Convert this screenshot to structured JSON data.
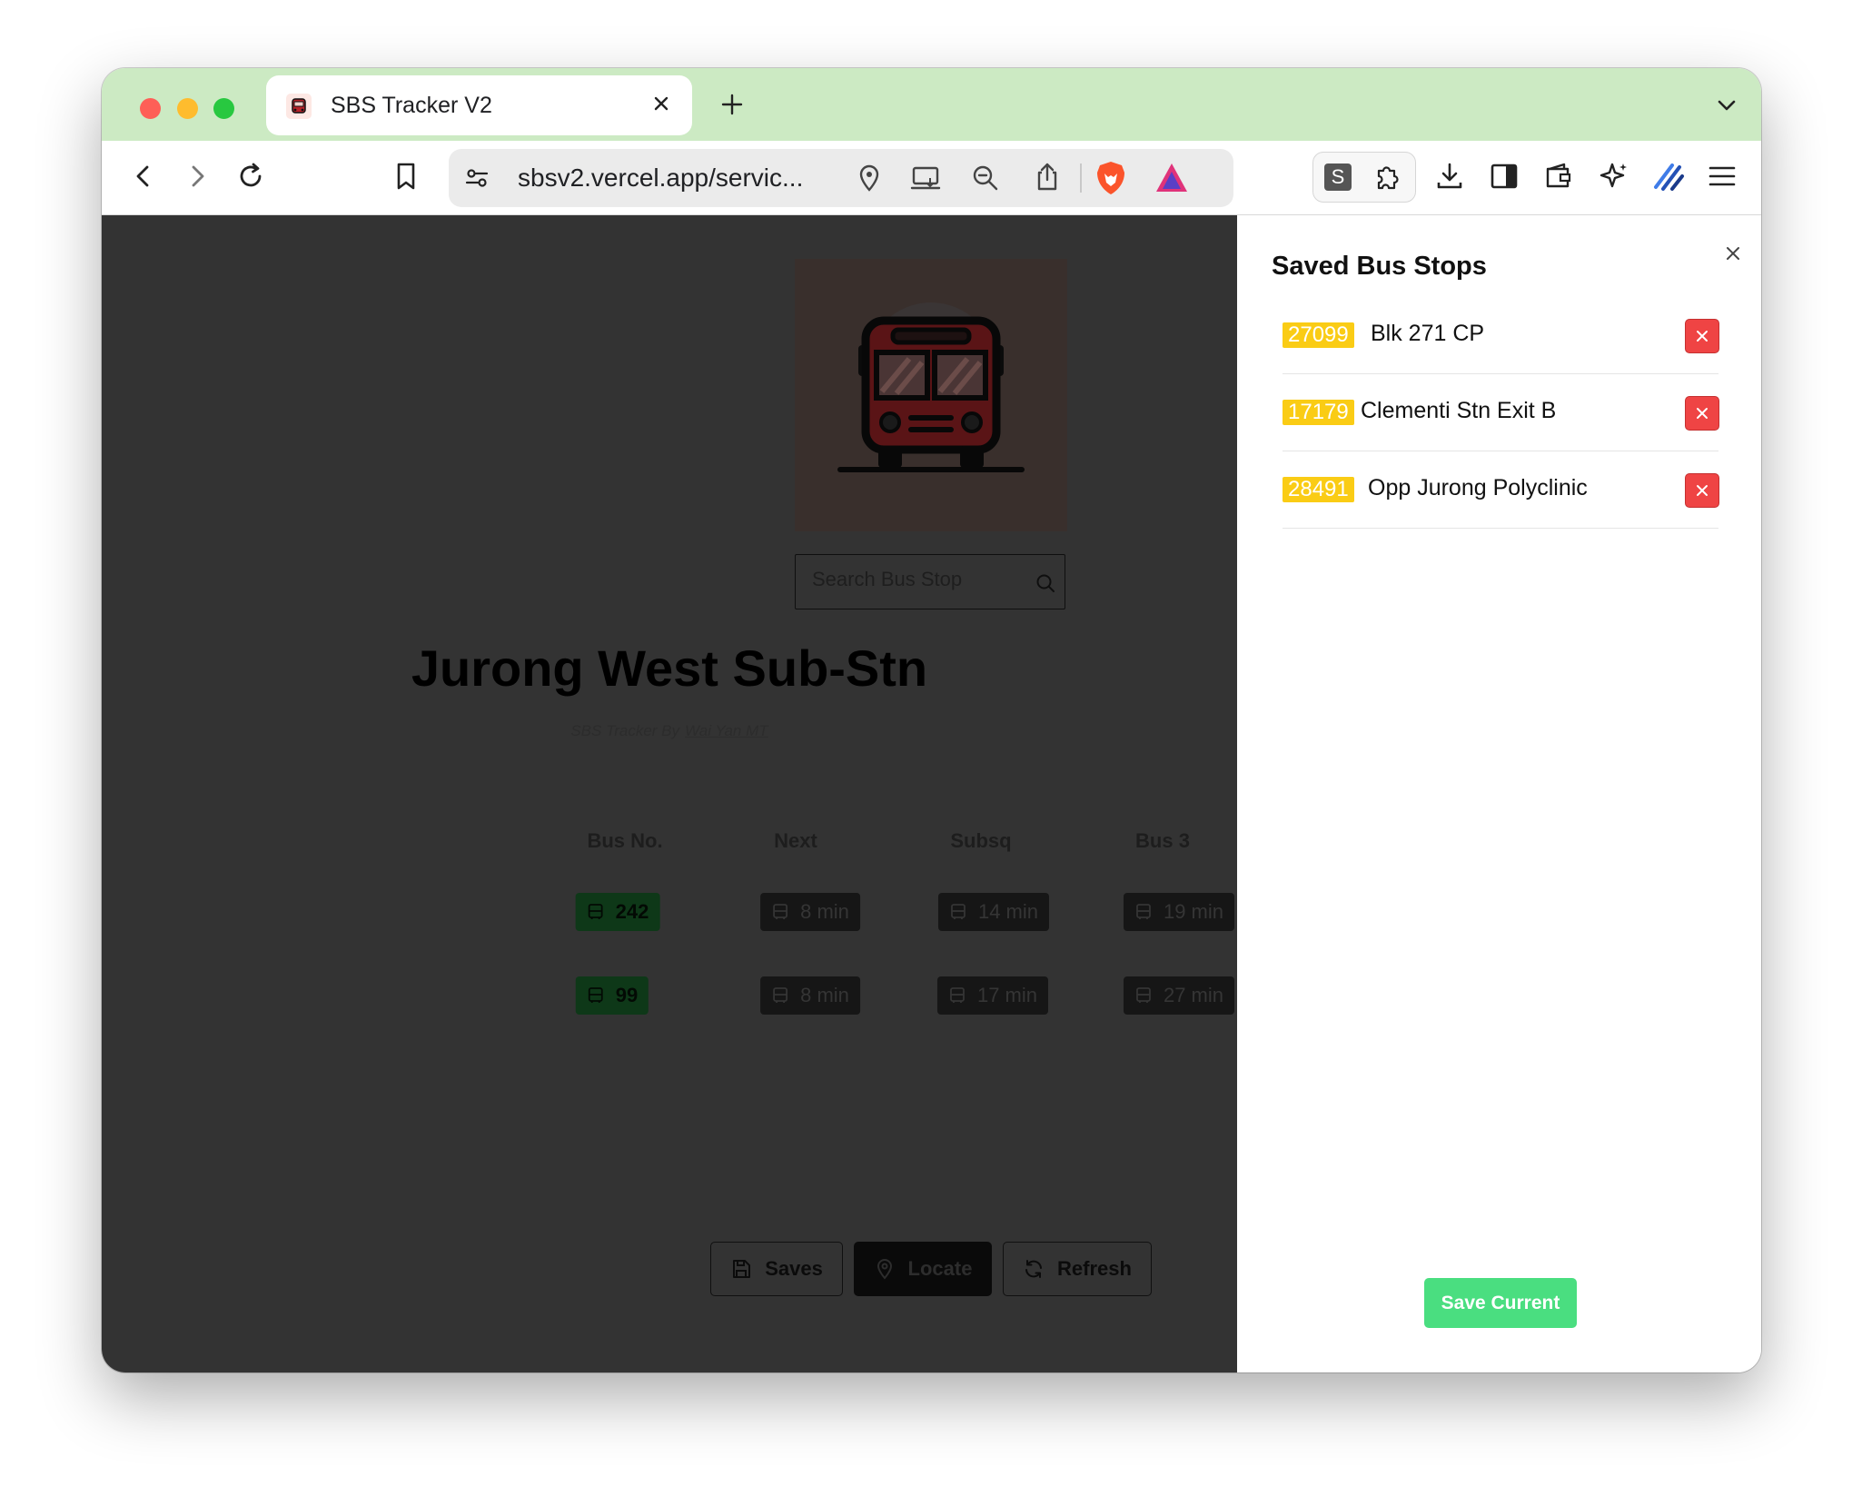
{
  "browser": {
    "tab_title": "SBS Tracker V2",
    "url": "sbsv2.vercel.app/servic...",
    "extension_badge": "S",
    "accent_color": "#cceac3"
  },
  "page": {
    "search": {
      "placeholder": "Search Bus Stop"
    },
    "title": "Jurong West Sub-Stn",
    "credit": {
      "prefix": "SBS Tracker By",
      "author": "Wai Yan MT"
    },
    "table": {
      "headers": [
        "Bus No.",
        "Next",
        "Subsq",
        "Bus 3"
      ],
      "rows": [
        {
          "bus": "242",
          "next": "8 min",
          "subsq": "14 min",
          "bus3": "19 min"
        },
        {
          "bus": "99",
          "next": "8 min",
          "subsq": "17 min",
          "bus3": "27 min"
        }
      ]
    },
    "buttons": {
      "saves": "Saves",
      "locate": "Locate",
      "refresh": "Refresh"
    }
  },
  "panel": {
    "title": "Saved Bus Stops",
    "stops": [
      {
        "code": "27099",
        "name": "Blk 271 CP"
      },
      {
        "code": "17179",
        "name": "Clementi Stn Exit B"
      },
      {
        "code": "28491",
        "name": "Opp Jurong Polyclinic"
      }
    ],
    "save_button": "Save Current",
    "colors": {
      "code_badge": "#facc15",
      "delete": "#ef4444",
      "save": "#4ade80"
    }
  }
}
